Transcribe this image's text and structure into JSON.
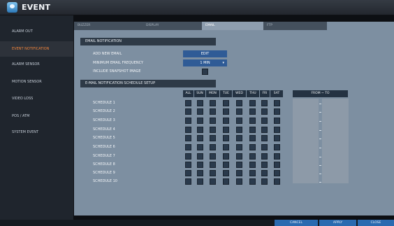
{
  "header": {
    "title": "EVENT"
  },
  "sidebar": {
    "items": [
      {
        "label": "ALARM OUT"
      },
      {
        "label": "EVENT NOTIFICATION"
      },
      {
        "label": "ALARM SENSOR"
      },
      {
        "label": "MOTION SENSOR"
      },
      {
        "label": "VIDEO LOSS"
      },
      {
        "label": "POS / ATM"
      },
      {
        "label": "SYSTEM EVENT"
      }
    ]
  },
  "tabs": [
    {
      "label": "BUZZER"
    },
    {
      "label": "DISPLAY"
    },
    {
      "label": "EMAIL"
    },
    {
      "label": "FTP"
    }
  ],
  "email_notification": {
    "header": "EMAIL NOTIFICATION",
    "add_label": "ADD NEW EMAIL",
    "edit_label": "EDIT",
    "frequency_label": "MINIMUM EMAIL FREQUENCY",
    "frequency_value": "1 MIN",
    "snapshot_label": "INCLUDE SNAPSHOT IMAGE"
  },
  "schedule": {
    "header": "E-MAIL NOTIFICATION SCHEDULE SETUP",
    "days": [
      "ALL",
      "SUN",
      "MON",
      "TUE",
      "WED",
      "THU",
      "FRI",
      "SAT"
    ],
    "from_to": "FROM ~ TO",
    "rows": [
      "SCHEDULE 1",
      "SCHEDULE 2",
      "SCHEDULE 3",
      "SCHEDULE 4",
      "SCHEDULE 5",
      "SCHEDULE 6",
      "SCHEDULE 7",
      "SCHEDULE 8",
      "SCHEDULE 9",
      "SCHEDULE 10"
    ]
  },
  "footer": {
    "cancel": "CANCEL",
    "apply": "APPLY",
    "close": "CLOSE"
  }
}
